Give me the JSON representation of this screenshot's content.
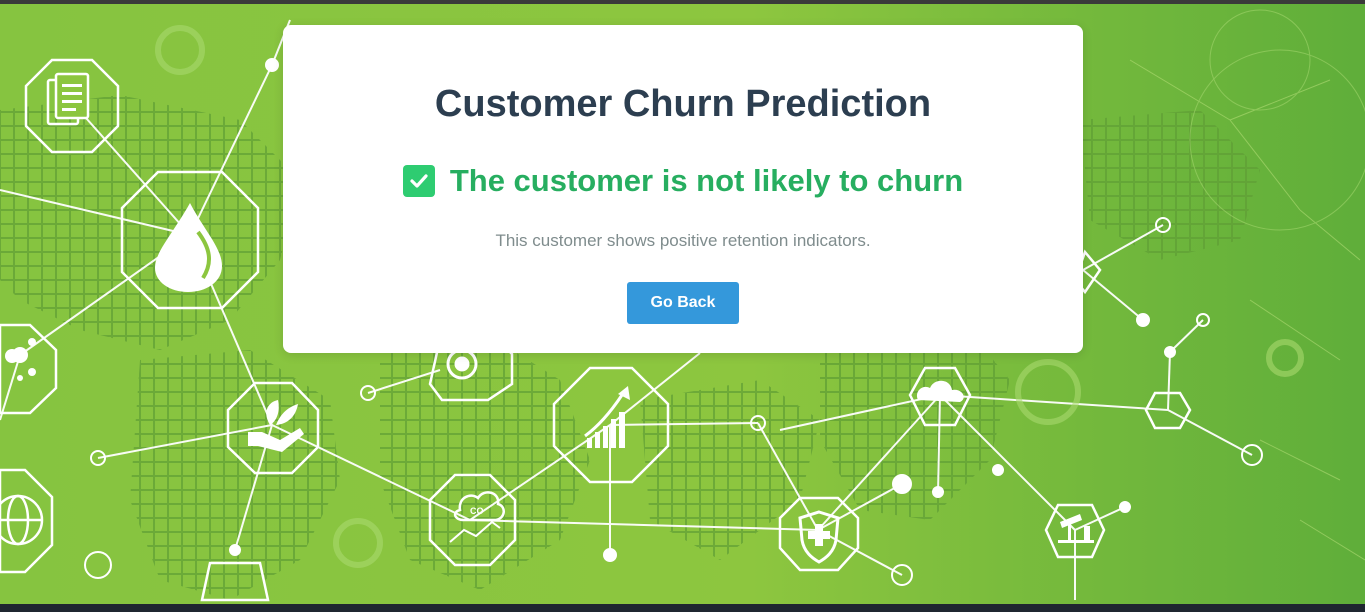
{
  "card": {
    "title": "Customer Churn Prediction",
    "result_text": "The customer is not likely to churn",
    "description": "This customer shows positive retention indicators.",
    "back_button_label": "Go Back"
  },
  "colors": {
    "background_green": "#8cc63f",
    "title": "#2c3e50",
    "result_green": "#27ae60",
    "check_badge": "#2ecc71",
    "description_gray": "#7f8c8d",
    "button_blue": "#3498db"
  },
  "icons": {
    "result": "check-square-icon",
    "background": [
      "document-icon",
      "water-drop-icon",
      "plant-hand-icon",
      "globe-icon",
      "target-icon",
      "growth-chart-icon",
      "co2-cloud-icon",
      "shield-cross-icon",
      "cloud-icon",
      "oil-pump-icon"
    ]
  }
}
